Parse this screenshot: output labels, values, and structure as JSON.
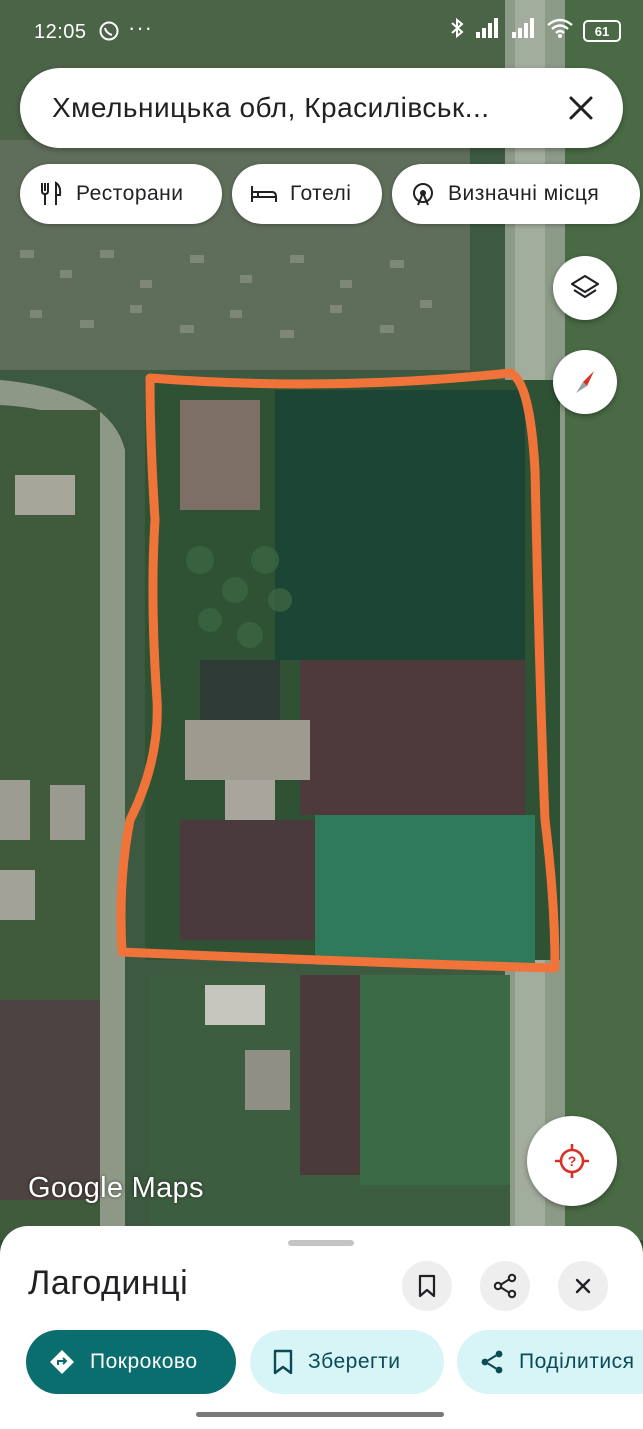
{
  "status_bar": {
    "time": "12:05",
    "dots": "···",
    "battery": "61",
    "icons": [
      "whatsapp-icon",
      "bluetooth-icon",
      "signal-icon",
      "signal-icon",
      "wifi-icon",
      "battery-icon"
    ]
  },
  "search": {
    "query": "Хмельницька обл, Красилівськ..."
  },
  "chips": [
    {
      "label": "Ресторани",
      "icon": "fork-knife-icon"
    },
    {
      "label": "Готелі",
      "icon": "bed-icon"
    },
    {
      "label": "Визначні місця",
      "icon": "landmark-icon"
    }
  ],
  "map": {
    "watermark": "Google Maps",
    "buttons": [
      "layers-icon",
      "compass-icon",
      "my-location-icon"
    ],
    "annotation_color": "#f0743a"
  },
  "place": {
    "title": "Лагодинці",
    "actions": {
      "directions": "Покроково",
      "save": "Зберегти",
      "share": "Поділитися"
    }
  },
  "colors": {
    "primary_button": "#0b6e6e",
    "secondary_button": "#d7f4f7"
  }
}
